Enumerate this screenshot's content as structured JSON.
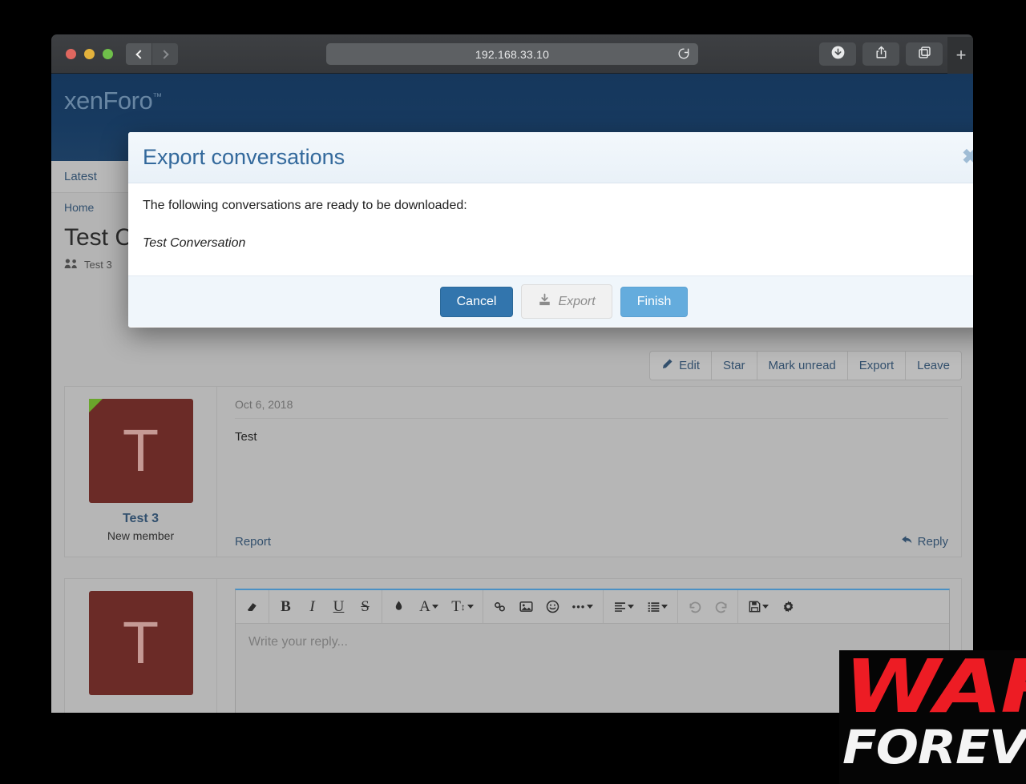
{
  "browser": {
    "url": "192.168.33.10",
    "traffic_lights": [
      "close",
      "minimize",
      "maximize"
    ],
    "back_label": "‹",
    "forward_label": "›",
    "reload_icon": "reload-icon",
    "downloads_icon": "downloads-icon",
    "share_icon": "share-icon",
    "tabs_icon": "tab-overview-icon",
    "new_tab_label": "+"
  },
  "site": {
    "brand": "xenForo",
    "brand_tm": "™",
    "nav_tabs": [
      {
        "label": "Latest"
      }
    ],
    "breadcrumb": "Home",
    "page_title": "Test Conversation",
    "participants_icon": "people-icon",
    "participants": "Test 3"
  },
  "action_bar": {
    "items": [
      {
        "label": "Edit",
        "icon": "pencil-icon"
      },
      {
        "label": "Star",
        "icon": null
      },
      {
        "label": "Mark unread",
        "icon": null
      },
      {
        "label": "Export",
        "icon": null
      },
      {
        "label": "Leave",
        "icon": null
      }
    ]
  },
  "message": {
    "avatar_letter": "T",
    "username": "Test 3",
    "user_title": "New member",
    "date": "Oct 6, 2018",
    "body": "Test",
    "report_label": "Report",
    "reply_label": "Reply"
  },
  "reply_box": {
    "avatar_letter": "T",
    "placeholder": "Write your reply...",
    "toolbar_groups": [
      [
        {
          "name": "remove-format-icon",
          "glyph": "▰"
        }
      ],
      [
        {
          "name": "bold-icon",
          "glyph": "B"
        },
        {
          "name": "italic-icon",
          "glyph": "I"
        },
        {
          "name": "underline-icon",
          "glyph": "U"
        },
        {
          "name": "strikethrough-icon",
          "glyph": "S"
        }
      ],
      [
        {
          "name": "text-color-icon",
          "glyph": "●"
        },
        {
          "name": "font-family-icon",
          "glyph": "A",
          "caret": true
        },
        {
          "name": "font-size-icon",
          "glyph": "T",
          "caret": true
        }
      ],
      [
        {
          "name": "link-icon",
          "glyph": "⚭"
        },
        {
          "name": "image-icon",
          "glyph": "▣"
        },
        {
          "name": "smilie-icon",
          "glyph": "☺"
        },
        {
          "name": "more-options-icon",
          "glyph": "•••",
          "caret": true
        }
      ],
      [
        {
          "name": "align-icon",
          "glyph": "≡",
          "caret": true
        },
        {
          "name": "list-icon",
          "glyph": "≣",
          "caret": true
        }
      ],
      [
        {
          "name": "undo-icon",
          "glyph": "↶",
          "disabled": true
        },
        {
          "name": "redo-icon",
          "glyph": "↷",
          "disabled": true
        }
      ],
      [
        {
          "name": "draft-icon",
          "glyph": "Ὃe",
          "caret": true
        },
        {
          "name": "gear-icon",
          "glyph": "⚙"
        }
      ]
    ]
  },
  "modal": {
    "title": "Export conversations",
    "close_label": "✖",
    "body_line_1": "The following conversations are ready to be downloaded:",
    "body_line_2": "Test Conversation",
    "buttons": {
      "cancel": "Cancel",
      "export": "Export",
      "export_icon": "download-icon",
      "finish": "Finish"
    }
  },
  "watermark": {
    "line_1": "WAR",
    "line_2": "FOREVER",
    "color_1": "#ed1c24",
    "color_2": "#ffffff",
    "background": "#050505"
  },
  "colors": {
    "header_blue": "#173a60",
    "link_blue": "#33506d",
    "modal_title_blue": "#33699c",
    "primary_button": "#3275ad",
    "secondary_button": "#64acdd",
    "avatar_bg": "#6b2b27"
  }
}
